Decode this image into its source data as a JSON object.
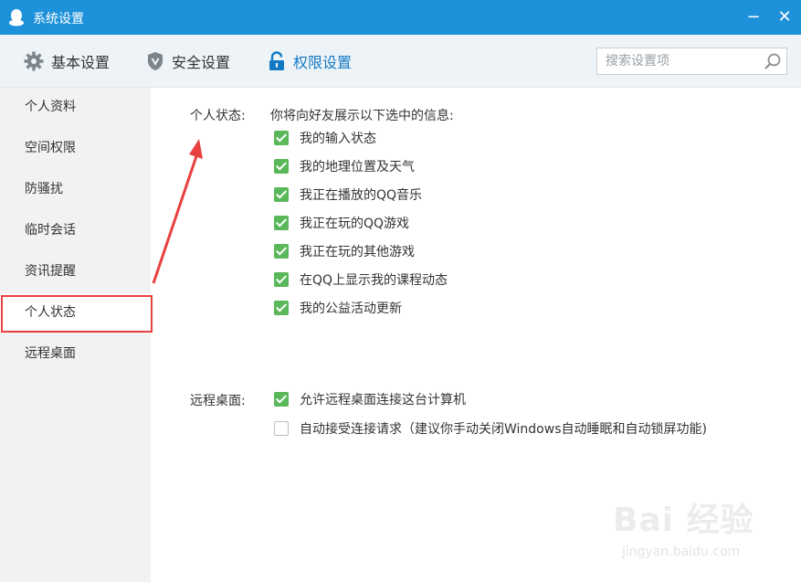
{
  "window": {
    "title": "系统设置",
    "minimize_label": "−",
    "close_label": "✕"
  },
  "tabs": [
    {
      "label": "基本设置",
      "icon": "gear-icon"
    },
    {
      "label": "安全设置",
      "icon": "shield-icon"
    },
    {
      "label": "权限设置",
      "icon": "lock-icon",
      "active": true
    }
  ],
  "search": {
    "placeholder": "搜索设置项"
  },
  "sidebar": {
    "items": [
      {
        "label": "个人资料"
      },
      {
        "label": "空间权限"
      },
      {
        "label": "防骚扰"
      },
      {
        "label": "临时会话"
      },
      {
        "label": "资讯提醒"
      },
      {
        "label": "个人状态",
        "active": true
      },
      {
        "label": "远程桌面"
      }
    ]
  },
  "personal_status": {
    "label": "个人状态:",
    "intro": "你将向好友展示以下选中的信息:",
    "options": [
      {
        "label": "我的输入状态",
        "checked": true
      },
      {
        "label": "我的地理位置及天气",
        "checked": true
      },
      {
        "label": "我正在播放的QQ音乐",
        "checked": true
      },
      {
        "label": "我正在玩的QQ游戏",
        "checked": true
      },
      {
        "label": "我正在玩的其他游戏",
        "checked": true
      },
      {
        "label": "在QQ上显示我的课程动态",
        "checked": true
      },
      {
        "label": "我的公益活动更新",
        "checked": true
      }
    ]
  },
  "remote_desktop": {
    "label": "远程桌面:",
    "options": [
      {
        "label": "允许远程桌面连接这台计算机",
        "checked": true
      },
      {
        "label": "自动接受连接请求（建议你手动关闭Windows自动睡眠和自动锁屏功能)",
        "checked": false
      }
    ]
  },
  "watermark": {
    "logo": "Bai 经验",
    "url": "jingyan.baidu.com"
  },
  "colors": {
    "titlebar": "#1e91db",
    "active_tab": "#1479c4",
    "checkbox_checked": "#5ab85a",
    "annotation_red": "#e8403f",
    "sidebar_bg": "#f2f2f2"
  }
}
